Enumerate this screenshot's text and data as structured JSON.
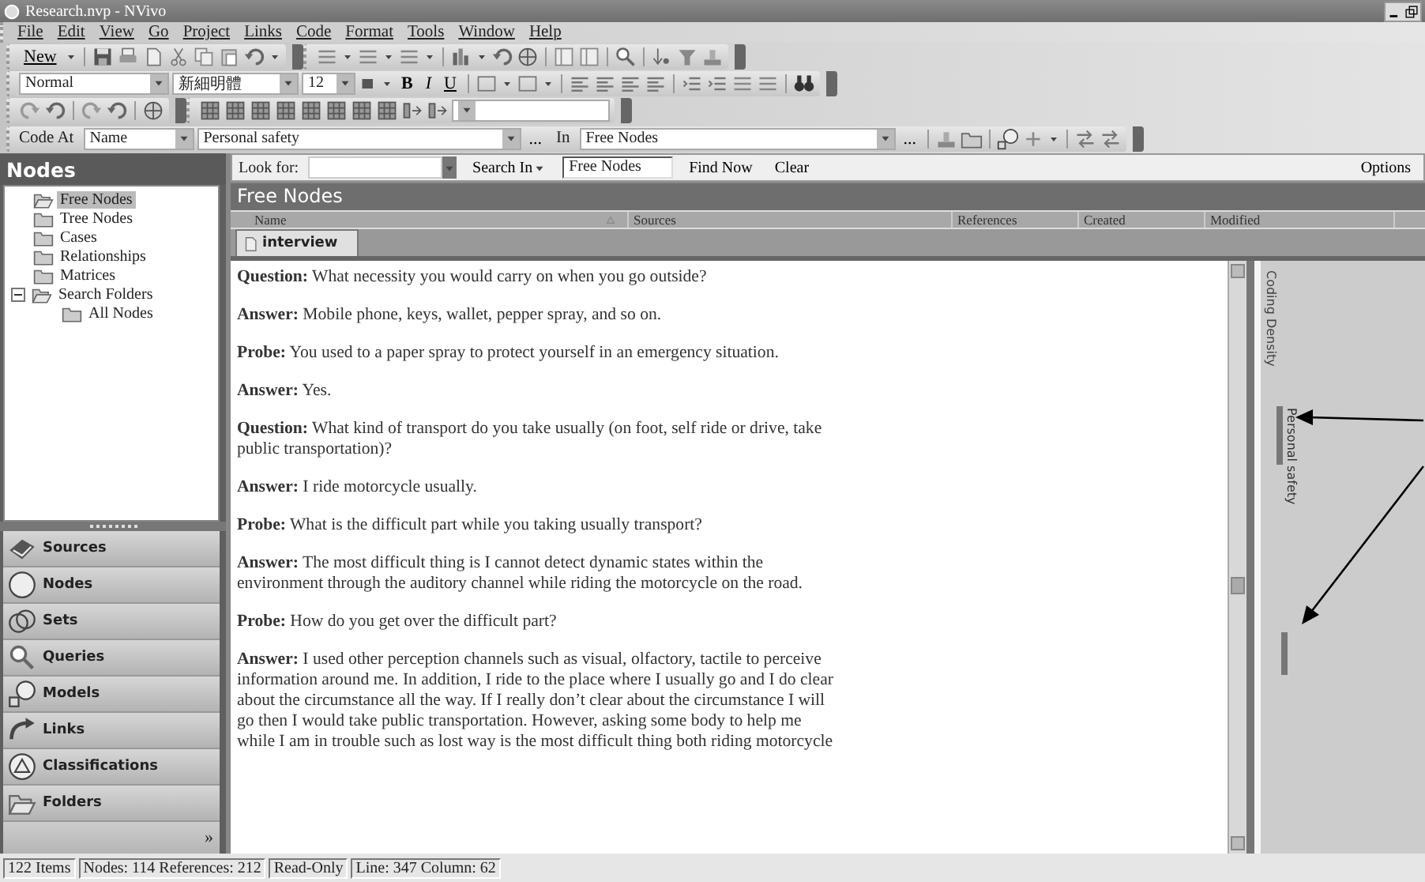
{
  "window": {
    "title": "Research.nvp - NVivo"
  },
  "menu": [
    "File",
    "Edit",
    "View",
    "Go",
    "Project",
    "Links",
    "Code",
    "Format",
    "Tools",
    "Window",
    "Help"
  ],
  "toolbar": {
    "new_button": "New"
  },
  "format_bar": {
    "style": "Normal",
    "font": "新細明體",
    "size": "12",
    "bold": "B",
    "italic": "I",
    "underline": "U"
  },
  "code_bar": {
    "label": "Code At",
    "field_type": "Name",
    "node": "Personal safety",
    "browse": "...",
    "in_label": "In",
    "location": "Free Nodes",
    "browse_2": "..."
  },
  "navigation": {
    "title": "Nodes",
    "tree": [
      {
        "label": "Free Nodes",
        "selected": true
      },
      {
        "label": "Tree Nodes",
        "selected": false
      },
      {
        "label": "Cases",
        "selected": false
      },
      {
        "label": "Relationships",
        "selected": false
      },
      {
        "label": "Matrices",
        "selected": false
      },
      {
        "label": "Search Folders",
        "selected": false,
        "expanded": true,
        "children": [
          {
            "label": "All Nodes",
            "selected": false
          }
        ]
      }
    ],
    "buttons": [
      {
        "label": "Sources",
        "selected": false
      },
      {
        "label": "Nodes",
        "selected": false
      },
      {
        "label": "Sets",
        "selected": false
      },
      {
        "label": "Queries",
        "selected": false
      },
      {
        "label": "Models",
        "selected": false
      },
      {
        "label": "Links",
        "selected": false
      },
      {
        "label": "Classifications",
        "selected": false
      },
      {
        "label": "Folders",
        "selected": false
      }
    ],
    "more": "»"
  },
  "find_bar": {
    "look_for": "Look for:",
    "search_in": "Search In",
    "scope": "Free Nodes",
    "find_now": "Find Now",
    "clear": "Clear",
    "options": "Options"
  },
  "list": {
    "title": "Free Nodes",
    "columns": [
      "Name",
      "Sources",
      "References",
      "Created",
      "Modified"
    ]
  },
  "document": {
    "tab": {
      "label": "interview",
      "selected": true
    },
    "paragraphs": [
      {
        "label": "Question:",
        "text": "What necessity you would carry on when you go outside?"
      },
      {
        "label": "Answer:",
        "text": "Mobile phone, keys, wallet, pepper spray, and so on."
      },
      {
        "label": "Probe:",
        "text": "You used to a paper spray to protect yourself in an emergency situation."
      },
      {
        "label": "Answer:",
        "text": "Yes."
      },
      {
        "label": "Question:",
        "text": "What kind of transport do you take usually (on foot, self ride or drive, take public transportation)?"
      },
      {
        "label": "Answer:",
        "text": "I ride motorcycle usually."
      },
      {
        "label": "Probe:",
        "text": "What is the difficult part while you taking usually transport?"
      },
      {
        "label": "Answer:",
        "text": "The most difficult thing is I cannot detect dynamic states within the environment through the auditory channel while riding the motorcycle on the road."
      },
      {
        "label": "Probe:",
        "text": "How do you get over the difficult part?"
      },
      {
        "label": "Answer:",
        "text": "I used other perception channels such as visual, olfactory, tactile to perceive information around me.  In addition, I ride to the place where I usually go and I do clear about the circumstance all the way.  If I really don’t clear about the circumstance I will go then I would take public transportation.  However, asking some body to help me while I am in trouble such as lost way is the most difficult thing both riding motorcycle"
      }
    ]
  },
  "coding_density": {
    "title": "Coding Density",
    "stripes": [
      {
        "kind": "labeled",
        "label": "Personal safety"
      },
      {
        "kind": "plain"
      }
    ]
  },
  "status_bar": [
    "122 Items",
    "Nodes: 114  References: 212",
    "Read-Only",
    "Line: 347 Column: 62"
  ]
}
